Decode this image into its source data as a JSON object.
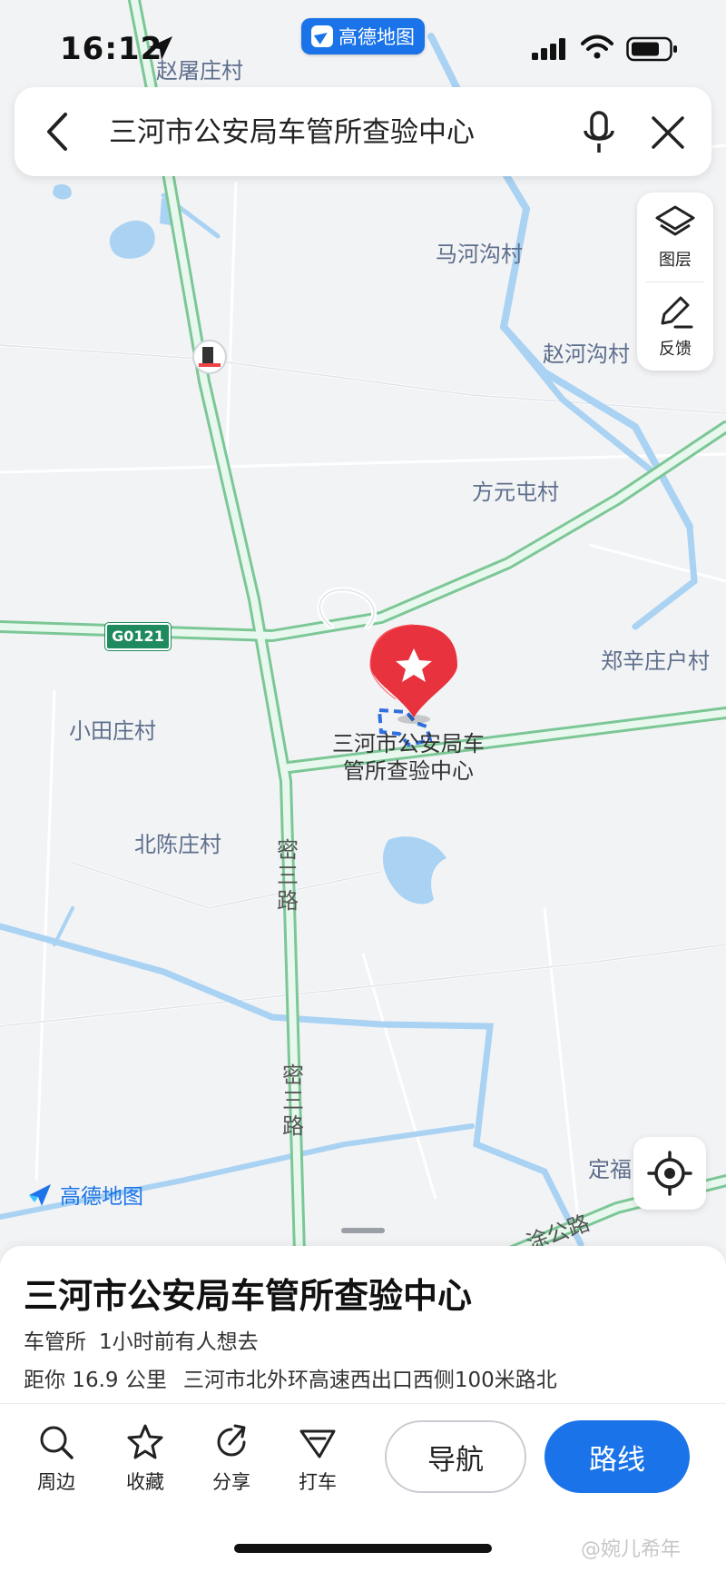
{
  "status_bar": {
    "time": "16:12"
  },
  "app_badge": {
    "label": "高德地图"
  },
  "search": {
    "query": "三河市公安局车管所查验中心"
  },
  "tools": [
    {
      "icon": "layers-icon",
      "label": "图层"
    },
    {
      "icon": "feedback-icon",
      "label": "反馈"
    }
  ],
  "map": {
    "villages": [
      "赵屠庄村",
      "马河沟村",
      "赵河沟村",
      "方元屯村",
      "郑辛庄户村",
      "小田庄村",
      "北陈庄村",
      "定福"
    ],
    "roads": [
      "密三路",
      "密三路",
      "涂公路"
    ],
    "highway_shield": "G0121",
    "poi": {
      "line1": "三河市公安局车",
      "line2": "管所查验中心"
    },
    "brand": "高德地图"
  },
  "place": {
    "title": "三河市公安局车管所查验中心",
    "category": "车管所",
    "popularity": "1小时前有人想去",
    "distance": "距你 16.9 公里",
    "address": "三河市北外环高速西出口西侧100米路北"
  },
  "actions": [
    {
      "icon": "search-icon",
      "label": "周边"
    },
    {
      "icon": "star-icon",
      "label": "收藏"
    },
    {
      "icon": "share-icon",
      "label": "分享"
    },
    {
      "icon": "taxi-icon",
      "label": "打车"
    }
  ],
  "buttons": {
    "navigate": "导航",
    "route": "路线"
  },
  "watermark": "@婉儿希年",
  "colors": {
    "accent": "#1a73e8",
    "marker": "#e8323d",
    "water": "#a9d2f3",
    "road_green": "#8fd3a6"
  }
}
